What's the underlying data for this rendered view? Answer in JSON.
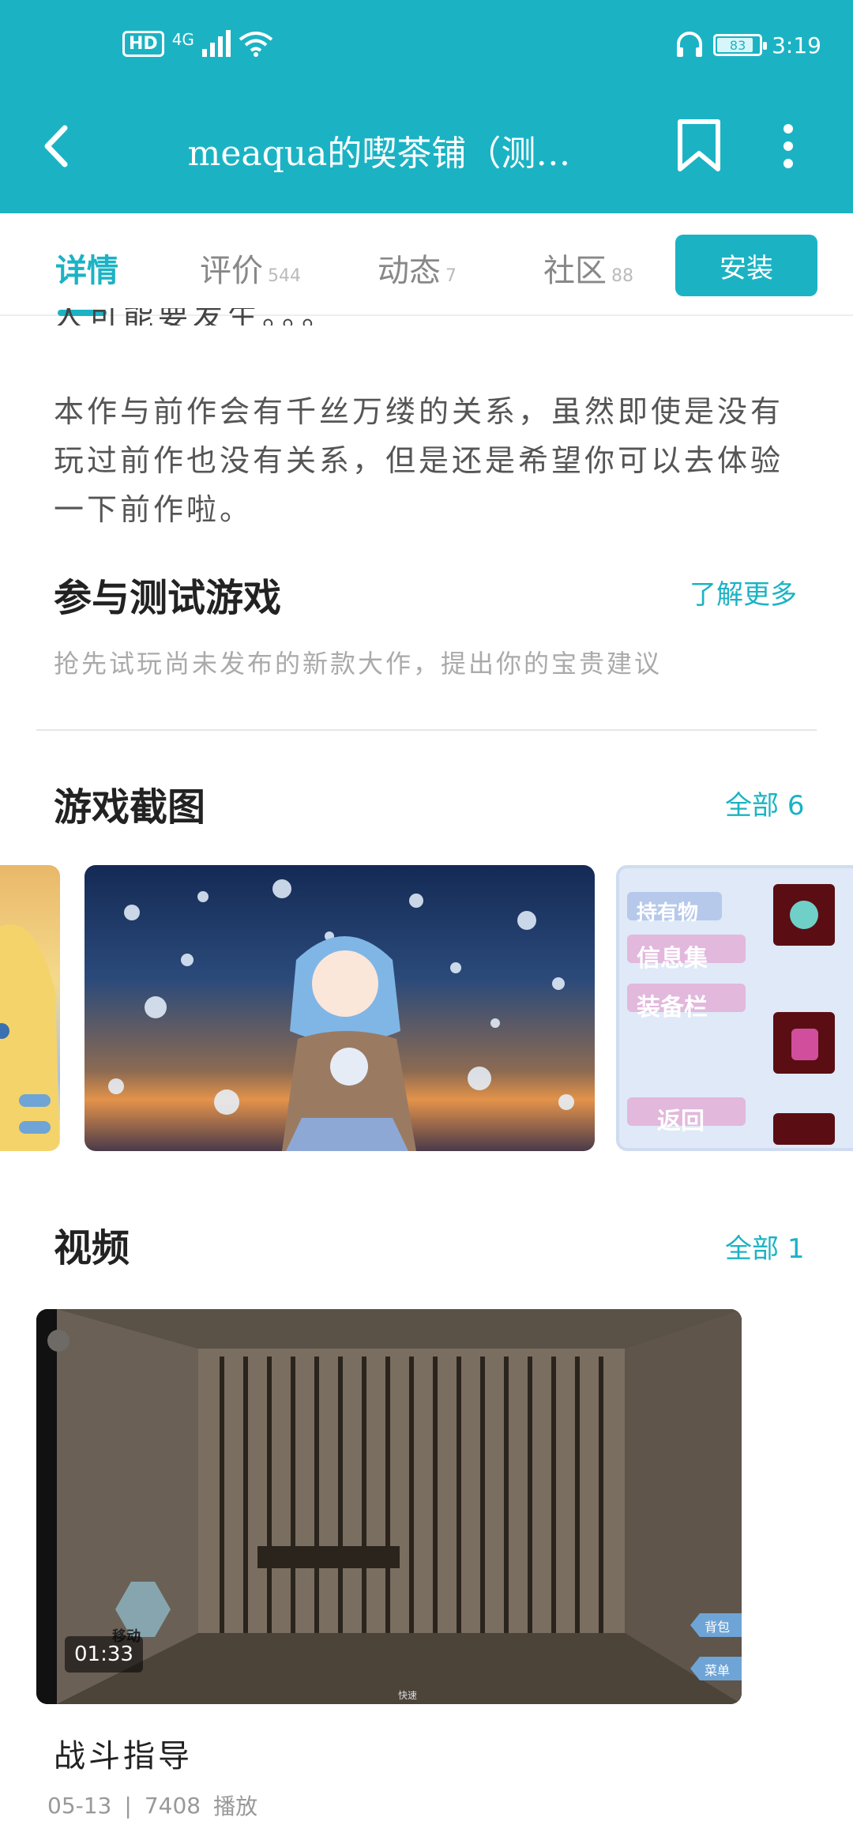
{
  "status": {
    "net": "4G",
    "hd": "HD",
    "battery": "83",
    "time": "3:19"
  },
  "header": {
    "title": "meaqua的喫茶铺（测…"
  },
  "tabs": [
    {
      "label": "详情",
      "count": ""
    },
    {
      "label": "评价",
      "count": "544"
    },
    {
      "label": "动态",
      "count": "7"
    },
    {
      "label": "社区",
      "count": "88"
    }
  ],
  "install_label": "安装",
  "intro": {
    "cut_text": "人可能要发生。。。",
    "paragraph": "本作与前作会有千丝万缕的关系，虽然即使是没有玩过前作也没有关系，但是还是希望你可以去体验一下前作啦。"
  },
  "beta": {
    "title": "参与测试游戏",
    "link": "了解更多",
    "subtitle": "抢先试玩尚未发布的新款大作，提出你的宝贵建议"
  },
  "screenshots": {
    "title": "游戏截图",
    "all_label": "全部",
    "count": "6",
    "panel_menu": [
      "信息集",
      "装备栏",
      "返回"
    ],
    "panel_title": "持有物"
  },
  "videos": {
    "title": "视频",
    "all_label": "全部",
    "count": "1",
    "items": [
      {
        "duration": "01:33",
        "title": "战斗指导",
        "date": "05-13",
        "plays": "7408",
        "plays_label": "播放",
        "overlay_move": "移动",
        "overlay_bag": "背包",
        "overlay_menu": "菜单",
        "overlay_fast": "快速"
      }
    ]
  }
}
